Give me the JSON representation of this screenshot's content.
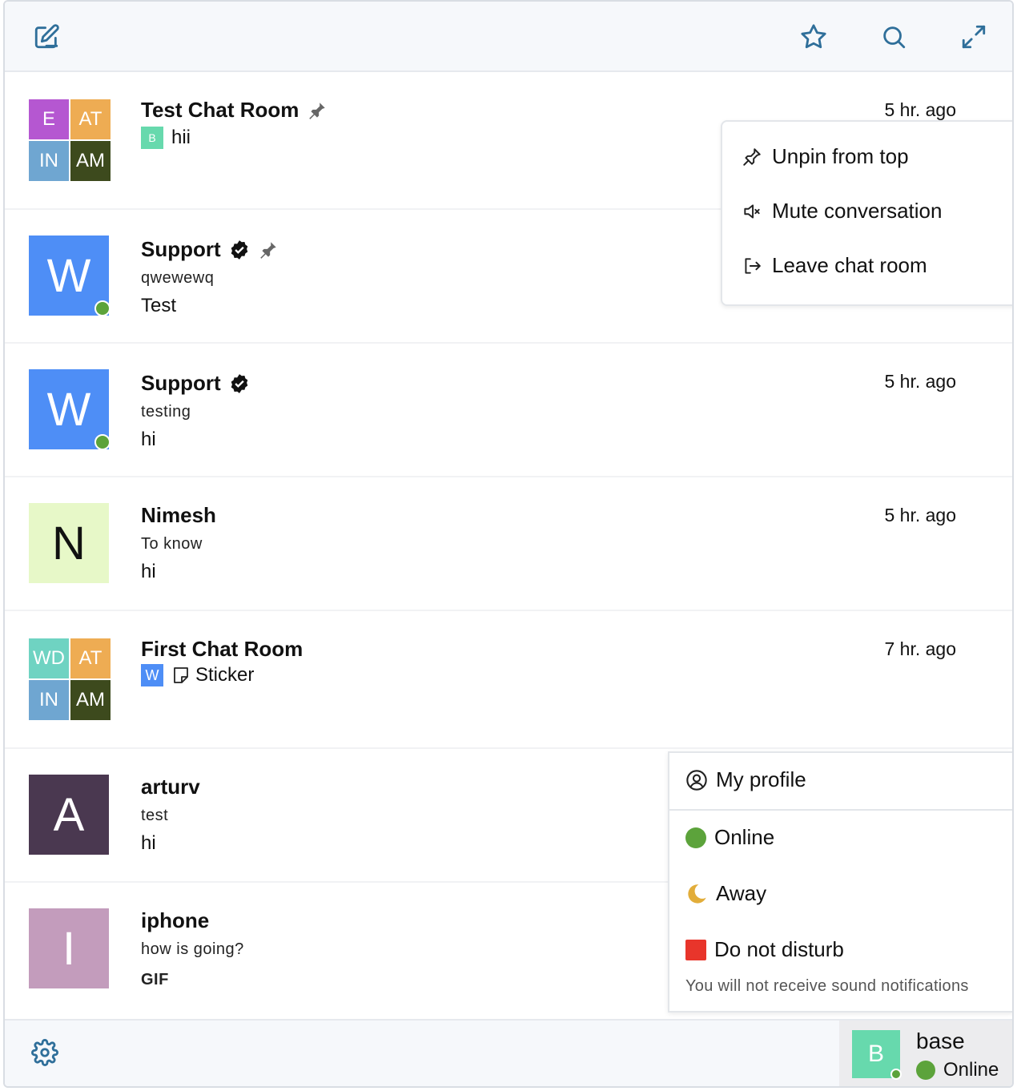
{
  "topbar": {
    "icons": [
      "compose-icon",
      "star-icon",
      "search-icon",
      "expand-icon"
    ]
  },
  "conversations": [
    {
      "title": "Test Chat Room",
      "pinned": true,
      "verified": false,
      "time": "5 hr. ago",
      "group_avatars": [
        {
          "text": "E",
          "color": "#b557d1"
        },
        {
          "text": "AT",
          "color": "#eeac53"
        },
        {
          "text": "IN",
          "color": "#6fa6d1"
        },
        {
          "text": "AM",
          "color": "#3d4a1d"
        }
      ],
      "sender_initial": "B",
      "sender_color": "#67d9ad",
      "message": "hii"
    },
    {
      "title": "Support",
      "pinned": true,
      "verified": true,
      "time": "",
      "avatar_text": "W",
      "avatar_color": "#4e8ef6",
      "online": true,
      "subline": "qwewewq",
      "message": "Test"
    },
    {
      "title": "Support",
      "pinned": false,
      "verified": true,
      "time": "5 hr. ago",
      "avatar_text": "W",
      "avatar_color": "#4e8ef6",
      "online": true,
      "subline": "testing",
      "message": "hi"
    },
    {
      "title": "Nimesh",
      "time": "5 hr. ago",
      "avatar_text": "N",
      "avatar_color": "#e7f8c8",
      "subline": "To know",
      "message": "hi"
    },
    {
      "title": "First Chat Room",
      "time": "7 hr. ago",
      "group_avatars": [
        {
          "text": "WD",
          "color": "#6fd3c2"
        },
        {
          "text": "AT",
          "color": "#eeac53"
        },
        {
          "text": "IN",
          "color": "#6fa6d1"
        },
        {
          "text": "AM",
          "color": "#3d4a1d"
        }
      ],
      "sender_initial": "W",
      "sender_color": "#4e8ef6",
      "message": "Sticker"
    },
    {
      "title": "arturv",
      "avatar_text": "A",
      "avatar_color": "#4a3850",
      "subline": "test",
      "message": "hi"
    },
    {
      "title": "iphone",
      "avatar_text": "I",
      "avatar_color": "#c39cbc",
      "subline": "how is going?",
      "message": "GIF"
    }
  ],
  "context_menu": {
    "items": [
      {
        "label": "Unpin from top",
        "icon": "pin-icon"
      },
      {
        "label": "Mute conversation",
        "icon": "mute-icon"
      },
      {
        "label": "Leave chat room",
        "icon": "leave-icon"
      }
    ]
  },
  "status_menu": {
    "profile_label": "My profile",
    "online_label": "Online",
    "away_label": "Away",
    "dnd_label": "Do not disturb",
    "dnd_note": "You will not receive sound notifications",
    "colors": {
      "online": "#5ca33b",
      "away": "#e2ad3a",
      "dnd": "#e8352b"
    }
  },
  "bottombar": {
    "user_initial": "B",
    "user_color": "#67d9ad",
    "username": "base",
    "status": "Online"
  }
}
